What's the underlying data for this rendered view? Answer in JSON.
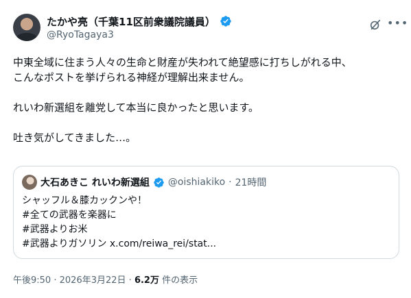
{
  "author": {
    "display_name": "たかや亮（千葉11区前衆議院議員）",
    "handle": "@RyoTagaya3"
  },
  "tweet": {
    "lines": [
      "中東全域に住まう人々の生命と財産が失われて絶望感に打ちしがれる中、",
      "こんなポストを挙げられる神経が理解出来ません。",
      "れいわ新選組を離党して本当に良かったと思います。",
      "吐き気がしてきました…。"
    ]
  },
  "quote": {
    "display_name": "大石あきこ れいわ新選組",
    "handle": "@oishiakiko",
    "separator": "·",
    "time": "21時間",
    "lines": [
      "シャッフル＆膝カックンや！",
      "#全ての武器を楽器に",
      "#武器よりお米",
      "#武器よりガソリン x.com/reiwa_rei/stat..."
    ]
  },
  "footer": {
    "time": "午後9:50",
    "separator": "·",
    "date": "2026年3月22日",
    "views_count": "6.2万",
    "views_label": " 件の表示"
  },
  "icons": {
    "verified": "verified-badge-icon",
    "grok": "grok-icon",
    "more": "more-options-icon"
  },
  "colors": {
    "verified_blue": "#1d9bf0",
    "secondary_text": "#536471"
  }
}
